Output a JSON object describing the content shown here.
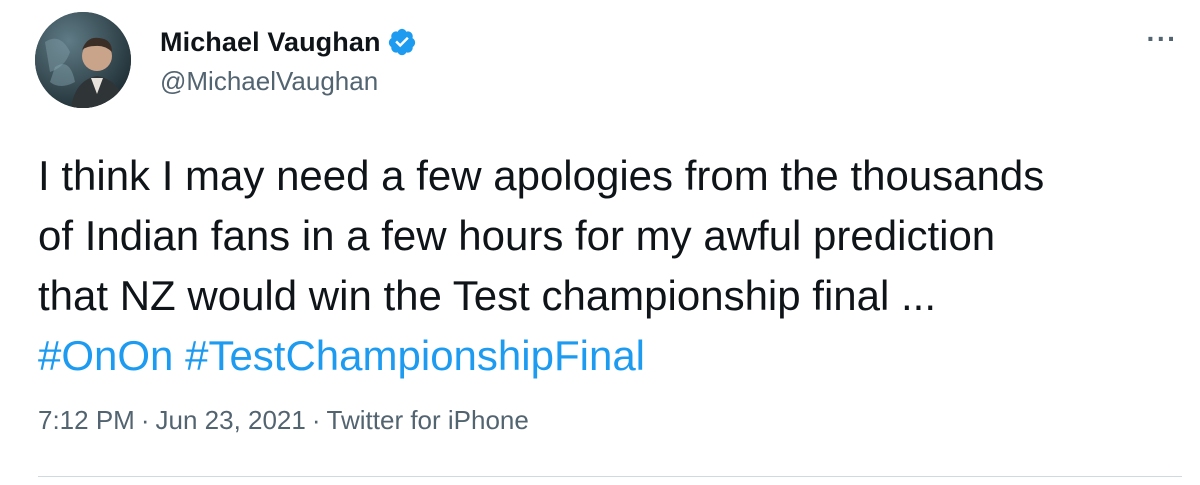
{
  "author": {
    "display_name": "Michael Vaughan",
    "handle": "@MichaelVaughan",
    "verified": true,
    "avatar_icon": "profile-photo"
  },
  "more_menu": {
    "icon": "more-horizontal-icon",
    "glyph": "···"
  },
  "tweet": {
    "lines": [
      "I think I may need a few apologies from the thousands",
      "of Indian fans in a few hours for my awful prediction",
      "that NZ would win the Test championship final ..."
    ],
    "hashtags": [
      "#OnOn",
      "#TestChampionshipFinal"
    ]
  },
  "meta": {
    "time": "7:12 PM",
    "date": "Jun 23, 2021",
    "source": "Twitter for iPhone",
    "separator": "·"
  },
  "colors": {
    "link": "#1d9bf0",
    "text": "#0f1419",
    "secondary": "#536471",
    "verified": "#1d9bf0"
  }
}
